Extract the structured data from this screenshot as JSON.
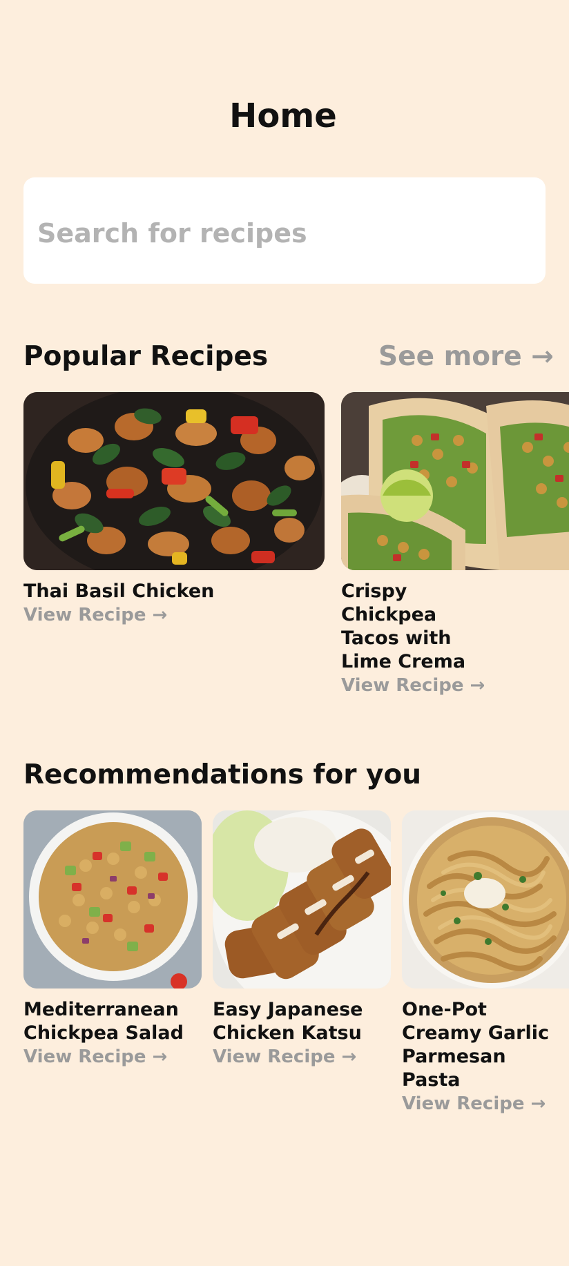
{
  "header": {
    "title": "Home"
  },
  "search": {
    "placeholder": "Search for recipes",
    "value": ""
  },
  "popular": {
    "title": "Popular Recipes",
    "see_more": "See more →",
    "recipes": [
      {
        "title": "Thai Basil Chicken",
        "link": "View Recipe →"
      },
      {
        "title": "Crispy Chickpea Tacos with Lime Crema",
        "link": "View Recipe →"
      }
    ]
  },
  "recommendations": {
    "title": "Recommendations for you",
    "recipes": [
      {
        "title": "Mediterranean Chickpea Salad",
        "link": "View Recipe →"
      },
      {
        "title": "Easy Japanese Chicken Katsu",
        "link": "View Recipe →"
      },
      {
        "title": "One-Pot Creamy Garlic Parmesan Pasta",
        "link": "View Recipe →"
      }
    ]
  },
  "colors": {
    "background": "#fdeedd",
    "text": "#111111",
    "muted": "#9a9a9a",
    "card": "#ffffff"
  }
}
